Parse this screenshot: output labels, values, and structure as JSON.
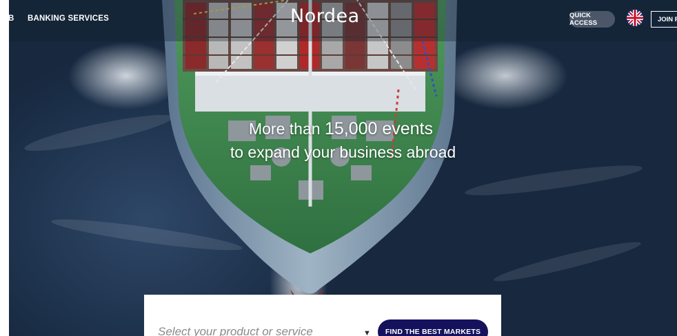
{
  "header": {
    "partial_nav_label": "B",
    "banking_services_label": "BANKING SERVICES",
    "logo_text": "Nordea",
    "quick_access_label": "QUICK ACCESS",
    "join_label": "JOIN FO"
  },
  "hero": {
    "headline_line1_prefix": "More than",
    "headline_line1_highlight": "15,000 events",
    "headline_line2": "to expand your business abroad"
  },
  "search": {
    "placeholder": "Select your product or service",
    "submit_label": "FIND THE BEST MARKETS"
  },
  "colors": {
    "button": "#15115c",
    "ship_deck": "#3e8a4e",
    "sea": "#1f344f"
  },
  "icons": {
    "language": "uk-flag-icon",
    "dropdown": "chevron-down-icon"
  }
}
